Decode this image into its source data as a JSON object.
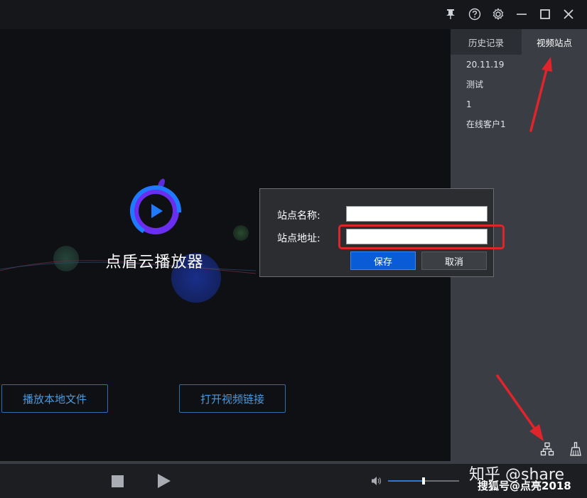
{
  "app": {
    "name": "点盾云播放器"
  },
  "titlebar": {
    "icons": [
      "pin-icon",
      "help-icon",
      "settings-icon",
      "minimize-icon",
      "maximize-icon",
      "close-icon"
    ]
  },
  "main": {
    "buttons": {
      "play_local": "播放本地文件",
      "open_link": "打开视频链接"
    }
  },
  "sidebar": {
    "tabs": [
      {
        "label": "历史记录",
        "active": false
      },
      {
        "label": "视频站点",
        "active": true
      }
    ],
    "sites": [
      "20.11.19",
      "测试",
      "1",
      "在线客户1"
    ],
    "icons": [
      "network-icon",
      "clear-broom-icon"
    ]
  },
  "dialog": {
    "name_label": "站点名称:",
    "name_value": "",
    "url_label": "站点地址:",
    "url_value": "",
    "save_label": "保存",
    "cancel_label": "取消"
  },
  "player": {
    "volume": 0.5
  },
  "watermark": {
    "line1": "知乎 @share",
    "line2": "搜狐号@点亮2018"
  },
  "colors": {
    "accent": "#0a5bd6",
    "annotation": "#e0242b",
    "link_button": "#4a9ae0"
  }
}
